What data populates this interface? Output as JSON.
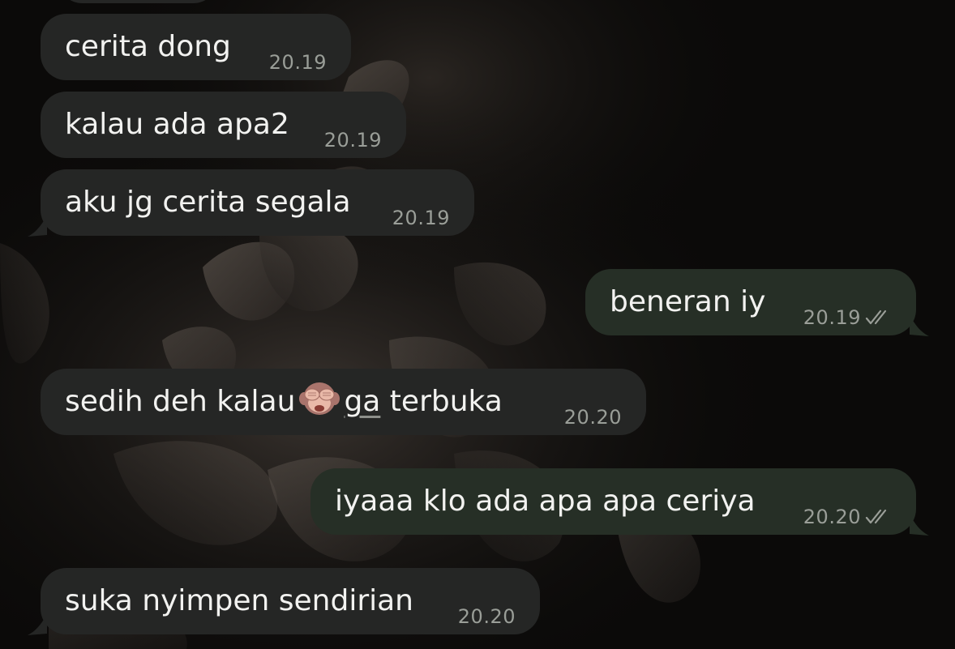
{
  "messages": [
    {
      "direction": "incoming",
      "text": "cerita dong",
      "time": "20.19"
    },
    {
      "direction": "incoming",
      "text": "kalau ada apa2",
      "time": "20.19"
    },
    {
      "direction": "incoming",
      "text": "aku jg cerita segala",
      "time": "20.19"
    },
    {
      "direction": "outgoing",
      "text": "beneran iy",
      "time": "20.19",
      "status": "read"
    },
    {
      "direction": "incoming",
      "text_before": "sedih deh kalau",
      "emoji": "see-no-evil-monkey",
      "text_link": "ga",
      "text_after": " terbuka",
      "time": "20.20"
    },
    {
      "direction": "outgoing",
      "text": "iyaaa klo ada apa apa ceriya",
      "time": "20.20",
      "status": "read"
    },
    {
      "direction": "incoming",
      "text": "suka nyimpen sendirian",
      "time": "20.20"
    }
  ],
  "colors": {
    "incoming_bubble": "#252625",
    "outgoing_bubble": "#262f26",
    "message_text": "#f2f2f0",
    "timestamp": "#9a9e98",
    "background": "#0b0a09"
  },
  "icons": [
    "double-check-icon",
    "see-no-evil-monkey-emoji",
    "bubble-tail"
  ]
}
